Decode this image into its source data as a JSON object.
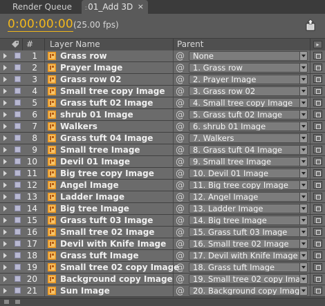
{
  "tabs": [
    {
      "label": "Render Queue",
      "active": false
    },
    {
      "label": "01_Add 3D",
      "active": true,
      "close": "×"
    }
  ],
  "comp": {
    "timecode": "0:00:00:00",
    "fps": "(25.00 fps)"
  },
  "columns": {
    "number": "#",
    "layer_name": "Layer Name",
    "parent": "Parent"
  },
  "colors": {
    "timecode": "#f2b81c",
    "label_swatch": "#b8b8d0",
    "footage_icon": "#e8931c"
  },
  "icons": {
    "expand": "disclosure-triangle-icon",
    "label": "label-swatch-icon",
    "footage": "footage-file-icon",
    "parent": "pick-whip-icon",
    "dropdown": "chevron-down-icon"
  },
  "layers": [
    {
      "num": "1",
      "name": "Grass row",
      "parent": "None"
    },
    {
      "num": "2",
      "name": "Prayer Image",
      "parent": "1. Grass row"
    },
    {
      "num": "3",
      "name": "Grass row 02",
      "parent": "2. Prayer Image"
    },
    {
      "num": "4",
      "name": "Small tree copy Image",
      "parent": "3. Grass row 02"
    },
    {
      "num": "5",
      "name": "Grass tuft 02 Image",
      "parent": "4. Small tree copy Image"
    },
    {
      "num": "6",
      "name": "shrub 01 Image",
      "parent": "5. Grass tuft 02 Image"
    },
    {
      "num": "7",
      "name": "Walkers",
      "parent": "6. shrub 01 Image"
    },
    {
      "num": "8",
      "name": "Grass tuft 04 Image",
      "parent": "7. Walkers"
    },
    {
      "num": "9",
      "name": "Small tree Image",
      "parent": "8. Grass tuft 04 Image"
    },
    {
      "num": "10",
      "name": "Devil 01 Image",
      "parent": "9. Small tree Image"
    },
    {
      "num": "11",
      "name": "Big tree copy Image",
      "parent": "10. Devil 01 Image"
    },
    {
      "num": "12",
      "name": "Angel Image",
      "parent": "11. Big tree copy Image"
    },
    {
      "num": "13",
      "name": "Ladder Image",
      "parent": "12. Angel Image"
    },
    {
      "num": "14",
      "name": "Big tree Image",
      "parent": "13. Ladder Image"
    },
    {
      "num": "15",
      "name": "Grass tuft 03 Image",
      "parent": "14. Big tree Image"
    },
    {
      "num": "16",
      "name": "Small tree 02 Image",
      "parent": "15. Grass tuft 03 Image"
    },
    {
      "num": "17",
      "name": "Devil with Knife Image",
      "parent": "16. Small tree 02 Image"
    },
    {
      "num": "18",
      "name": "Grass tuft Image",
      "parent": "17. Devil with Knife Image"
    },
    {
      "num": "19",
      "name": "Small tree 02 copy Image",
      "parent": "18. Grass tuft Image"
    },
    {
      "num": "20",
      "name": "Background copy Image",
      "parent": "19. Small tree 02 copy Image"
    },
    {
      "num": "21",
      "name": "Sun Image",
      "parent": "20. Background copy Image"
    }
  ]
}
